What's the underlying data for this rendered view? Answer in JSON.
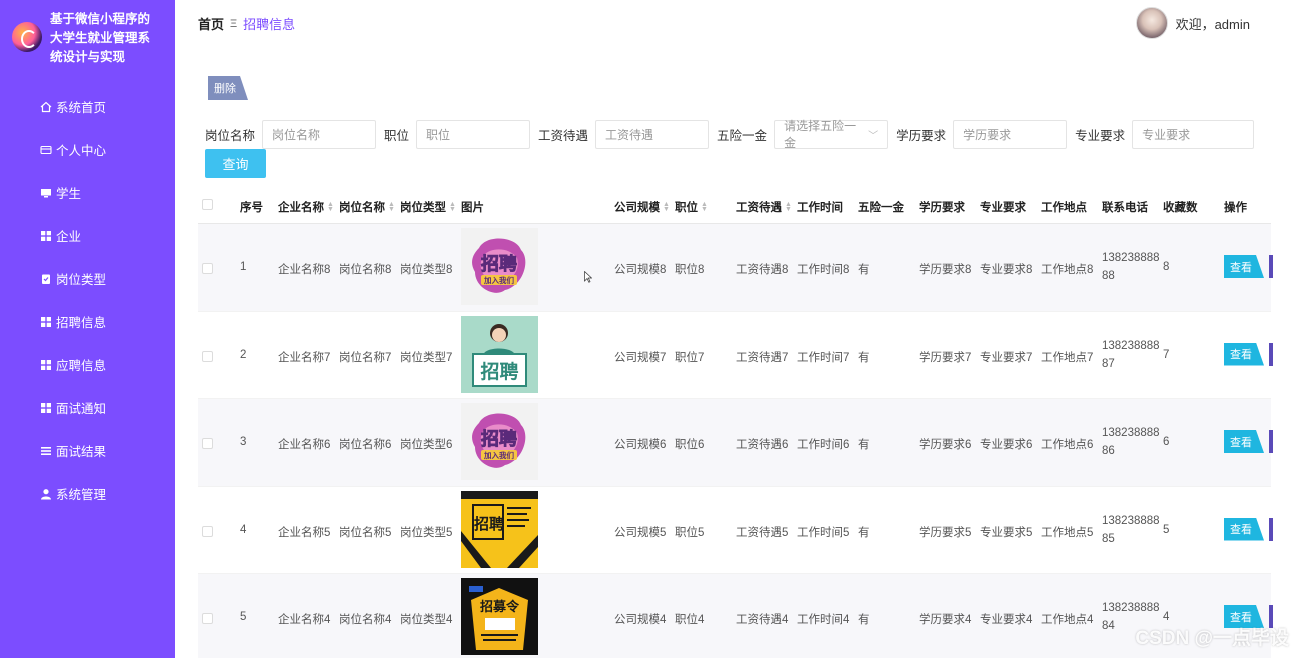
{
  "app": {
    "title": "基于微信小程序的大学生就业管理系统设计与实现"
  },
  "sidebar": {
    "items": [
      {
        "label": "系统首页",
        "icon": "home-icon"
      },
      {
        "label": "个人中心",
        "icon": "card-icon"
      },
      {
        "label": "学生",
        "icon": "monitor-icon"
      },
      {
        "label": "企业",
        "icon": "grid-icon"
      },
      {
        "label": "岗位类型",
        "icon": "clipboard-icon"
      },
      {
        "label": "招聘信息",
        "icon": "grid-icon"
      },
      {
        "label": "应聘信息",
        "icon": "grid-icon"
      },
      {
        "label": "面试通知",
        "icon": "grid-icon"
      },
      {
        "label": "面试结果",
        "icon": "list-icon"
      },
      {
        "label": "系统管理",
        "icon": "user-icon"
      }
    ]
  },
  "header": {
    "breadcrumb_home": "首页",
    "breadcrumb_sep": "Ξ",
    "breadcrumb_current": "招聘信息",
    "welcome": "欢迎，admin"
  },
  "toolbar": {
    "delete_label": "删除",
    "query_label": "查询"
  },
  "search": {
    "fields": [
      {
        "label": "岗位名称",
        "placeholder": "岗位名称"
      },
      {
        "label": "职位",
        "placeholder": "职位"
      },
      {
        "label": "工资待遇",
        "placeholder": "工资待遇"
      },
      {
        "label": "五险一金",
        "placeholder": "请选择五险一金"
      },
      {
        "label": "学历要求",
        "placeholder": "学历要求"
      },
      {
        "label": "专业要求",
        "placeholder": "专业要求"
      }
    ]
  },
  "table": {
    "headers": [
      "序号",
      "企业名称",
      "岗位名称",
      "岗位类型",
      "图片",
      "公司规模",
      "职位",
      "工资待遇",
      "工作时间",
      "五险一金",
      "学历要求",
      "专业要求",
      "工作地点",
      "联系电话",
      "收藏数",
      "操作"
    ],
    "view_label": "查看",
    "rows": [
      {
        "no": "1",
        "company": "企业名称8",
        "post": "岗位名称8",
        "type": "岗位类型8",
        "image": "poster-purple",
        "scale": "公司规模8",
        "position": "职位8",
        "salary": "工资待遇8",
        "hours": "工作时间8",
        "insurance": "有",
        "edu": "学历要求8",
        "major": "专业要求8",
        "place": "工作地点8",
        "phone1": "138238888",
        "phone2": "88",
        "fav": "8"
      },
      {
        "no": "2",
        "company": "企业名称7",
        "post": "岗位名称7",
        "type": "岗位类型7",
        "image": "poster-green",
        "scale": "公司规模7",
        "position": "职位7",
        "salary": "工资待遇7",
        "hours": "工作时间7",
        "insurance": "有",
        "edu": "学历要求7",
        "major": "专业要求7",
        "place": "工作地点7",
        "phone1": "138238888",
        "phone2": "87",
        "fav": "7"
      },
      {
        "no": "3",
        "company": "企业名称6",
        "post": "岗位名称6",
        "type": "岗位类型6",
        "image": "poster-purple",
        "scale": "公司规模6",
        "position": "职位6",
        "salary": "工资待遇6",
        "hours": "工作时间6",
        "insurance": "有",
        "edu": "学历要求6",
        "major": "专业要求6",
        "place": "工作地点6",
        "phone1": "138238888",
        "phone2": "86",
        "fav": "6"
      },
      {
        "no": "4",
        "company": "企业名称5",
        "post": "岗位名称5",
        "type": "岗位类型5",
        "image": "poster-yellow",
        "scale": "公司规模5",
        "position": "职位5",
        "salary": "工资待遇5",
        "hours": "工作时间5",
        "insurance": "有",
        "edu": "学历要求5",
        "major": "专业要求5",
        "place": "工作地点5",
        "phone1": "138238888",
        "phone2": "85",
        "fav": "5"
      },
      {
        "no": "5",
        "company": "企业名称4",
        "post": "岗位名称4",
        "type": "岗位类型4",
        "image": "poster-dark",
        "scale": "公司规模4",
        "position": "职位4",
        "salary": "工资待遇4",
        "hours": "工作时间4",
        "insurance": "有",
        "edu": "学历要求4",
        "major": "专业要求4",
        "place": "工作地点4",
        "phone1": "138238888",
        "phone2": "84",
        "fav": "4"
      }
    ]
  },
  "posters": {
    "purple_main": "招聘",
    "purple_sub": "加入我们",
    "green_main": "招聘",
    "yellow_main": "招聘",
    "dark_main": "招募令"
  },
  "watermark": "CSDN @一点毕设",
  "colors": {
    "sidebar": "#7c4dff",
    "accent": "#7c4dff",
    "query": "#3ec1f0",
    "view": "#1fb6e0",
    "delete": "#7f8ebd"
  }
}
